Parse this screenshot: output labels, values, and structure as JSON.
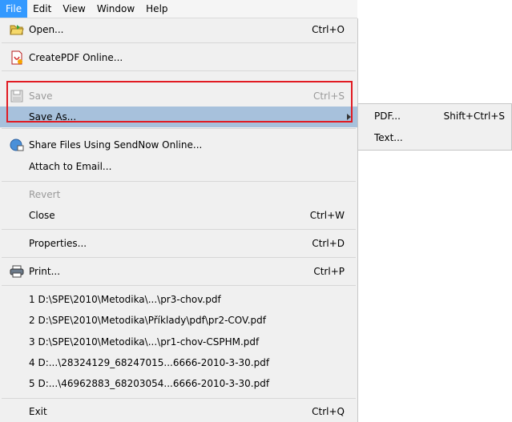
{
  "menubar": {
    "items": [
      "File",
      "Edit",
      "View",
      "Window",
      "Help"
    ],
    "active": "File"
  },
  "menu": {
    "items": [
      {
        "label": "Open...",
        "shortcut": "Ctrl+O",
        "icon": "folder-open-icon"
      },
      {
        "label": "CreatePDF Online...",
        "shortcut": "",
        "icon": "createpdf-icon"
      },
      {
        "label": "Save",
        "shortcut": "Ctrl+S",
        "icon": "save-disk-icon",
        "disabled": true
      },
      {
        "label": "Save As...",
        "shortcut": "",
        "icon": "",
        "highlighted": true,
        "has_submenu": true
      },
      {
        "label": "Share Files Using SendNow Online...",
        "shortcut": "",
        "icon": "sendnow-icon"
      },
      {
        "label": "Attach to Email...",
        "shortcut": "",
        "icon": ""
      },
      {
        "label": "Revert",
        "shortcut": "",
        "icon": "",
        "disabled": true
      },
      {
        "label": "Close",
        "shortcut": "Ctrl+W",
        "icon": ""
      },
      {
        "label": "Properties...",
        "shortcut": "Ctrl+D",
        "icon": ""
      },
      {
        "label": "Print...",
        "shortcut": "Ctrl+P",
        "icon": "printer-icon"
      },
      {
        "label": "1 D:\\SPE\\2010\\Metodika\\...\\pr3-chov.pdf",
        "shortcut": "",
        "icon": ""
      },
      {
        "label": "2 D:\\SPE\\2010\\Metodika\\Příklady\\pdf\\pr2-COV.pdf",
        "shortcut": "",
        "icon": ""
      },
      {
        "label": "3 D:\\SPE\\2010\\Metodika\\...\\pr1-chov-CSPHM.pdf",
        "shortcut": "",
        "icon": ""
      },
      {
        "label": "4 D:...\\28324129_68247015...6666-2010-3-30.pdf",
        "shortcut": "",
        "icon": ""
      },
      {
        "label": "5 D:...\\46962883_68203054...6666-2010-3-30.pdf",
        "shortcut": "",
        "icon": ""
      },
      {
        "label": "Exit",
        "shortcut": "Ctrl+Q",
        "icon": ""
      }
    ]
  },
  "submenu": {
    "items": [
      {
        "label": "PDF...",
        "shortcut": "Shift+Ctrl+S"
      },
      {
        "label": "Text...",
        "shortcut": ""
      }
    ]
  },
  "colors": {
    "highlight": "#a7c1dc",
    "active_menu": "#3399ff",
    "annotation_box": "#e11b22"
  }
}
